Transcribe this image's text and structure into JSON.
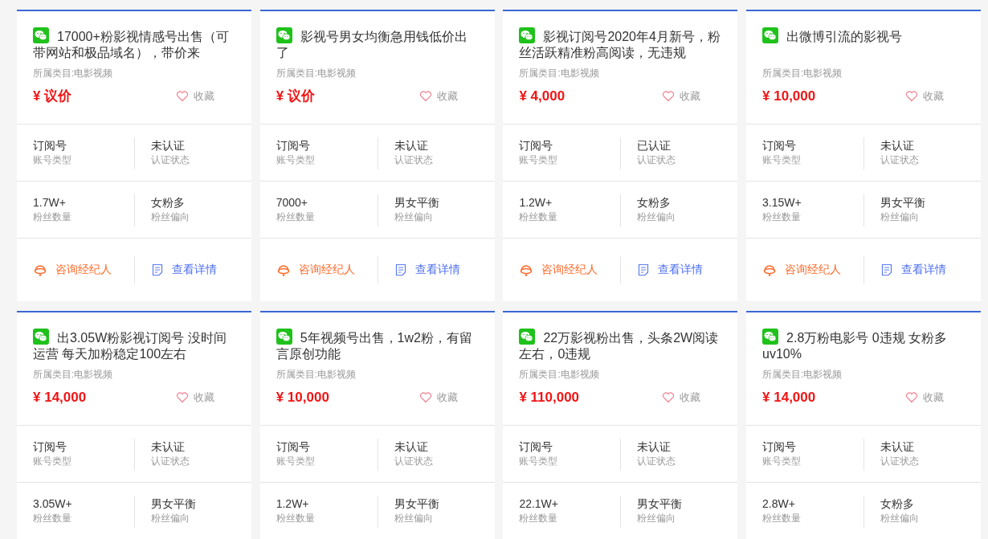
{
  "listings": [
    {
      "title": "17000+粉影视情感号出售（可带网站和极品域名），带价来",
      "category": "所属类目:电影视频",
      "price": "¥ 议价",
      "favorite_label": "收藏",
      "favorited": false,
      "stats": [
        {
          "value": "订阅号",
          "label": "账号类型"
        },
        {
          "value": "未认证",
          "label": "认证状态"
        },
        {
          "value": "1.7W+",
          "label": "粉丝数量"
        },
        {
          "value": "女粉多",
          "label": "粉丝偏向"
        }
      ],
      "actions": [
        {
          "kind": "consult",
          "label": "咨询经纪人"
        },
        {
          "kind": "details",
          "label": "查看详情"
        }
      ]
    },
    {
      "title": "影视号男女均衡急用钱低价出了",
      "category": "所属类目:电影视频",
      "price": "¥ 议价",
      "favorite_label": "收藏",
      "favorited": false,
      "stats": [
        {
          "value": "订阅号",
          "label": "账号类型"
        },
        {
          "value": "未认证",
          "label": "认证状态"
        },
        {
          "value": "7000+",
          "label": "粉丝数量"
        },
        {
          "value": "男女平衡",
          "label": "粉丝偏向"
        }
      ],
      "actions": [
        {
          "kind": "consult",
          "label": "咨询经纪人"
        },
        {
          "kind": "details",
          "label": "查看详情"
        }
      ]
    },
    {
      "title": "影视订阅号2020年4月新号，粉丝活跃精准粉高阅读，无违规",
      "category": "所属类目:电影视频",
      "price": "¥ 4,000",
      "favorite_label": "收藏",
      "favorited": false,
      "stats": [
        {
          "value": "订阅号",
          "label": "账号类型"
        },
        {
          "value": "已认证",
          "label": "认证状态"
        },
        {
          "value": "1.2W+",
          "label": "粉丝数量"
        },
        {
          "value": "女粉多",
          "label": "粉丝偏向"
        }
      ],
      "actions": [
        {
          "kind": "consult",
          "label": "咨询经纪人"
        },
        {
          "kind": "details",
          "label": "查看详情"
        }
      ]
    },
    {
      "title": "出微博引流的影视号",
      "category": "所属类目:电影视频",
      "price": "¥ 10,000",
      "favorite_label": "收藏",
      "favorited": false,
      "stats": [
        {
          "value": "订阅号",
          "label": "账号类型"
        },
        {
          "value": "未认证",
          "label": "认证状态"
        },
        {
          "value": "3.15W+",
          "label": "粉丝数量"
        },
        {
          "value": "男女平衡",
          "label": "粉丝偏向"
        }
      ],
      "actions": [
        {
          "kind": "consult",
          "label": "咨询经纪人"
        },
        {
          "kind": "details",
          "label": "查看详情"
        }
      ]
    },
    {
      "title": "出3.05W粉影视订阅号 没时间运营 每天加粉稳定100左右",
      "category": "所属类目:电影视频",
      "price": "¥ 14,000",
      "favorite_label": "收藏",
      "favorited": false,
      "stats": [
        {
          "value": "订阅号",
          "label": "账号类型"
        },
        {
          "value": "未认证",
          "label": "认证状态"
        },
        {
          "value": "3.05W+",
          "label": "粉丝数量"
        },
        {
          "value": "男女平衡",
          "label": "粉丝偏向"
        }
      ]
    },
    {
      "title": "5年视频号出售，1w2粉，有留言原创功能",
      "category": "所属类目:电影视频",
      "price": "¥ 10,000",
      "favorite_label": "收藏",
      "favorited": false,
      "stats": [
        {
          "value": "订阅号",
          "label": "账号类型"
        },
        {
          "value": "未认证",
          "label": "认证状态"
        },
        {
          "value": "1.2W+",
          "label": "粉丝数量"
        },
        {
          "value": "男女平衡",
          "label": "粉丝偏向"
        }
      ]
    },
    {
      "title": "22万影视粉出售，头条2W阅读左右，0违规",
      "category": "所属类目:电影视频",
      "price": "¥ 110,000",
      "favorite_label": "收藏",
      "favorited": false,
      "stats": [
        {
          "value": "订阅号",
          "label": "账号类型"
        },
        {
          "value": "未认证",
          "label": "认证状态"
        },
        {
          "value": "22.1W+",
          "label": "粉丝数量"
        },
        {
          "value": "男女平衡",
          "label": "粉丝偏向"
        }
      ]
    },
    {
      "title": "2.8万粉电影号 0违规 女粉多uv10%",
      "category": "所属类目:电影视频",
      "price": "¥ 14,000",
      "favorite_label": "收藏",
      "favorited": false,
      "stats": [
        {
          "value": "订阅号",
          "label": "账号类型"
        },
        {
          "value": "未认证",
          "label": "认证状态"
        },
        {
          "value": "2.8W+",
          "label": "粉丝数量"
        },
        {
          "value": "女粉多",
          "label": "粉丝偏向"
        }
      ]
    }
  ]
}
